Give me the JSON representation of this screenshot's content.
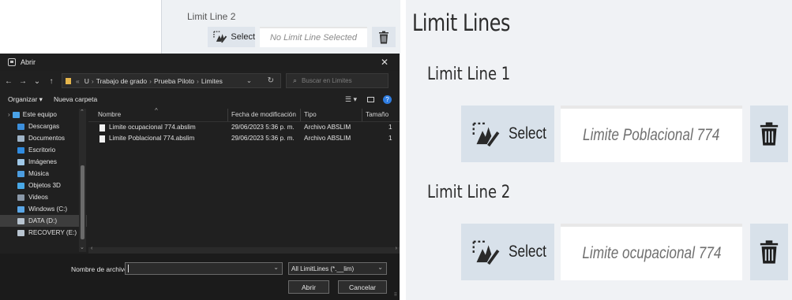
{
  "top_strip": {
    "label": "Limit Line 2",
    "select_label": "Select",
    "field_placeholder": "No Limit Line Selected"
  },
  "dialog": {
    "title": "Abrir",
    "close_glyph": "✕",
    "nav": {
      "back": "←",
      "forward": "→",
      "recent": "⌄",
      "up": "↑"
    },
    "address": {
      "prefix": "«",
      "crumbs": [
        "U",
        "Trabajo de grado",
        "Prueba Piloto",
        "Limites"
      ],
      "separator": "›"
    },
    "search_placeholder": "Buscar en Limites",
    "toolbar": {
      "organize": "Organizar ▾",
      "new_folder": "Nueva carpeta",
      "view_glyph": "☰ ▾",
      "help_glyph": "?"
    },
    "sidebar": [
      {
        "label": "Este equipo",
        "icon": "computer-icon",
        "color": "#4aa3e8",
        "top": true
      },
      {
        "label": "Descargas",
        "icon": "downloads-icon",
        "color": "#3c8fdc"
      },
      {
        "label": "Documentos",
        "icon": "documents-icon",
        "color": "#9fb4c8"
      },
      {
        "label": "Escritorio",
        "icon": "desktop-icon",
        "color": "#2f8be0"
      },
      {
        "label": "Imágenes",
        "icon": "pictures-icon",
        "color": "#9fc8e8"
      },
      {
        "label": "Música",
        "icon": "music-icon",
        "color": "#4c9de0"
      },
      {
        "label": "Objetos 3D",
        "icon": "objects-3d-icon",
        "color": "#49a8e6"
      },
      {
        "label": "Videos",
        "icon": "videos-icon",
        "color": "#8a98a8"
      },
      {
        "label": "Windows (C:)",
        "icon": "drive-c-icon",
        "color": "#5aa6e6"
      },
      {
        "label": "DATA (D:)",
        "icon": "drive-d-icon",
        "color": "#b8c4d0",
        "selected": true
      },
      {
        "label": "RECOVERY (E:)",
        "icon": "drive-e-icon",
        "color": "#b8c4d0"
      }
    ],
    "columns": [
      "Nombre",
      "Fecha de modificación",
      "Tipo",
      "Tamaño"
    ],
    "files": [
      {
        "name": "Limite ocupacional 774.abslim",
        "date": "29/06/2023 5:36 p. m.",
        "type": "Archivo ABSLIM",
        "size": "1"
      },
      {
        "name": "Limite Poblacional 774.abslim",
        "date": "29/06/2023 5:36 p. m.",
        "type": "Archivo ABSLIM",
        "size": "1"
      }
    ],
    "footer": {
      "filename_label": "Nombre de archivo:",
      "filename_value": "",
      "filetype_value": "All LimitLines (*.__lim)",
      "open_label": "Abrir",
      "cancel_label": "Cancelar"
    }
  },
  "panel": {
    "title": "Limit Lines",
    "lines": [
      {
        "label": "Limit Line 1",
        "select_label": "Select",
        "value": "Limite Poblacional 774"
      },
      {
        "label": "Limit Line 2",
        "select_label": "Select",
        "value": "Limite ocupacional 774"
      }
    ]
  },
  "colors": {
    "select_bg": "#d8e1ea",
    "panel_bg": "#f0f2f5",
    "dialog_bg": "#202020",
    "help_blue": "#2f7de1",
    "folder_yellow": "#e6b64c"
  }
}
